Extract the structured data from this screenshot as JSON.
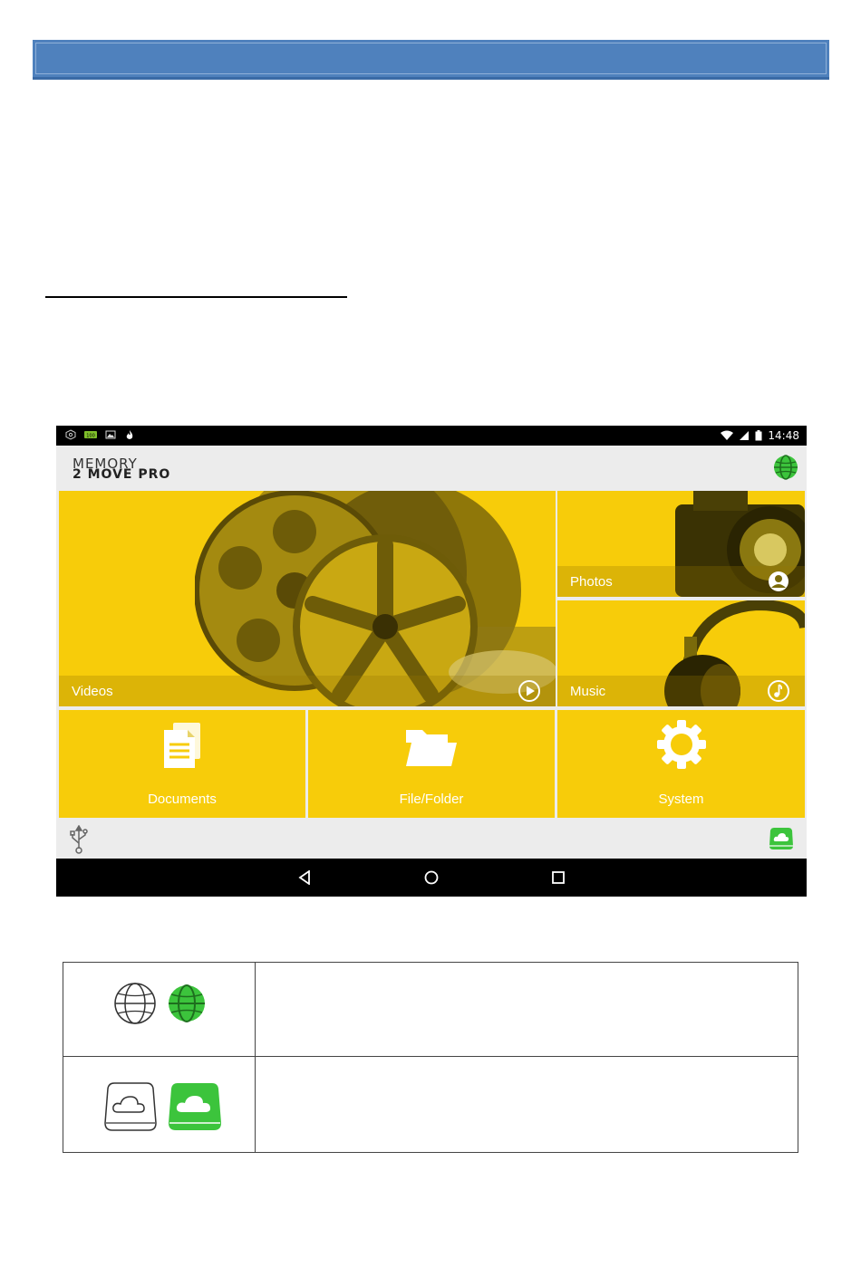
{
  "status_bar": {
    "time": "14:48"
  },
  "app": {
    "logo_line1": "MEMORY",
    "logo_line2": "2 MOVE PRO"
  },
  "tiles": {
    "videos": "Videos",
    "photos": "Photos",
    "music": "Music",
    "documents": "Documents",
    "file_folder": "File/Folder",
    "system": "System"
  },
  "colors": {
    "tile_yellow": "#f7cc0a",
    "accent_green": "#3cc43c",
    "header_blue": "#4f81bd"
  },
  "icons": {
    "globe": "globe-icon",
    "cloud_drive": "cloud-drive-icon",
    "usb": "usb-icon"
  }
}
